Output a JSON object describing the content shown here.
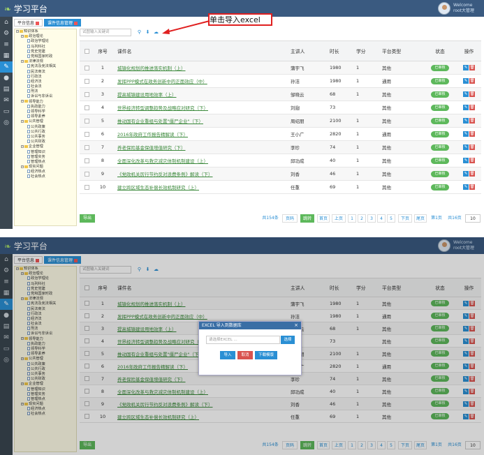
{
  "app": {
    "title": "学习平台",
    "welcome_line1": "Welcome",
    "welcome_line2": "root大管理"
  },
  "tabs": [
    {
      "label": "平台信息"
    },
    {
      "label": "课件信息管理"
    }
  ],
  "sidebar_icons": [
    "home-icon",
    "settings-icon",
    "list-icon",
    "grid-icon",
    "pen-icon",
    "chat-icon",
    "document-icon",
    "mail-icon",
    "monitor-icon",
    "circle-icon"
  ],
  "tree": [
    {
      "level": 1,
      "kind": "folder",
      "label": "知识体系"
    },
    {
      "level": 2,
      "kind": "folder",
      "label": "政治理论"
    },
    {
      "level": 3,
      "kind": "file",
      "label": "政治学理论"
    },
    {
      "level": 3,
      "kind": "file",
      "label": "马列科社"
    },
    {
      "level": 3,
      "kind": "file",
      "label": "党史党建"
    },
    {
      "level": 3,
      "kind": "file",
      "label": "党和国家时政"
    },
    {
      "level": 2,
      "kind": "folder",
      "label": "法律法规"
    },
    {
      "level": 3,
      "kind": "file",
      "label": "宪法及宪法相关"
    },
    {
      "level": 3,
      "kind": "file",
      "label": "民法商法"
    },
    {
      "level": 3,
      "kind": "file",
      "label": "行政法"
    },
    {
      "level": 3,
      "kind": "file",
      "label": "经济法"
    },
    {
      "level": 3,
      "kind": "file",
      "label": "社会法"
    },
    {
      "level": 3,
      "kind": "file",
      "label": "刑法"
    },
    {
      "level": 3,
      "kind": "file",
      "label": "诉讼与非诉讼"
    },
    {
      "level": 2,
      "kind": "folder",
      "label": "领导能力"
    },
    {
      "level": 3,
      "kind": "file",
      "label": "执政能力"
    },
    {
      "level": 3,
      "kind": "file",
      "label": "领导科学"
    },
    {
      "level": 3,
      "kind": "file",
      "label": "领导素养"
    },
    {
      "level": 2,
      "kind": "folder",
      "label": "公共管理"
    },
    {
      "level": 3,
      "kind": "file",
      "label": "公共政策"
    },
    {
      "level": 3,
      "kind": "file",
      "label": "公共行政"
    },
    {
      "level": 3,
      "kind": "file",
      "label": "公共事务"
    },
    {
      "level": 3,
      "kind": "file",
      "label": "公共财政"
    },
    {
      "level": 2,
      "kind": "folder",
      "label": "企业管理"
    },
    {
      "level": 3,
      "kind": "file",
      "label": "管理知识"
    },
    {
      "level": 3,
      "kind": "file",
      "label": "管理实务"
    },
    {
      "level": 3,
      "kind": "file",
      "label": "管理热点"
    },
    {
      "level": 2,
      "kind": "folder",
      "label": "现实问题"
    },
    {
      "level": 3,
      "kind": "file",
      "label": "经济热点"
    },
    {
      "level": 3,
      "kind": "file",
      "label": "社会热点"
    }
  ],
  "search": {
    "placeholder": "试图输入关键词"
  },
  "toolbar_icons": [
    "search-icon",
    "download-icon",
    "upload-icon"
  ],
  "table": {
    "headers": {
      "num": "序号",
      "name": "课件名",
      "speaker": "主讲人",
      "duration": "时长",
      "credit": "学分",
      "platform": "平台类型",
      "status": "状态",
      "ops": "操作"
    },
    "rows": [
      {
        "num": "1",
        "name": "城镇化规划的推进落实机制（上）",
        "speaker": "蒲宇飞",
        "duration": "1980",
        "credit": "1",
        "platform": "其他",
        "status": "已审核"
      },
      {
        "num": "2",
        "name": "发挥PPP模式在政务创新中的正面效应（中）",
        "speaker": "孙洁",
        "duration": "1980",
        "credit": "1",
        "platform": "通用",
        "status": "已审核"
      },
      {
        "num": "3",
        "name": "提高城镇建设用地效率（上）",
        "speaker": "邹晓云",
        "duration": "68",
        "credit": "1",
        "platform": "其他",
        "status": "已审核"
      },
      {
        "num": "4",
        "name": "世界经济转型调整趋势及战略应对研究（下）",
        "speaker": "刘翅",
        "duration": "73",
        "credit": "",
        "platform": "其他",
        "status": "已审核"
      },
      {
        "num": "5",
        "name": "推动国有企业重组与处置\"僵尸企业\"（下）",
        "speaker": "周绍朋",
        "duration": "2100",
        "credit": "1",
        "platform": "其他",
        "status": "已审核"
      },
      {
        "num": "6",
        "name": "2016年政府工作报告精解读（下）",
        "speaker": "王小广",
        "duration": "2820",
        "credit": "1",
        "platform": "通用",
        "status": "已审核"
      },
      {
        "num": "7",
        "name": "养老保险基金保值增值研究（下）",
        "speaker": "李珍",
        "duration": "74",
        "credit": "1",
        "platform": "其他",
        "status": "已审核"
      },
      {
        "num": "8",
        "name": "全面深化改革与救灾减灾体制机制建设（上）",
        "speaker": "邱功成",
        "duration": "40",
        "credit": "1",
        "platform": "其他",
        "status": "已审核"
      },
      {
        "num": "9",
        "name": "《党政机关厉行节约反对浪费条例》解读（下）",
        "speaker": "刘香",
        "duration": "46",
        "credit": "1",
        "platform": "其他",
        "status": "已审核"
      },
      {
        "num": "10",
        "name": "建立跨区域生态补偿长效机制研究（上）",
        "speaker": "任重",
        "duration": "69",
        "credit": "1",
        "platform": "其他",
        "status": "已审核"
      }
    ]
  },
  "pager": {
    "export_label": "导出",
    "total_text": "共154条",
    "page_label": "页码",
    "go_label": "跳转",
    "first": "首页",
    "prev": "上页",
    "pages": [
      "1",
      "2",
      "3",
      "4",
      "5"
    ],
    "next": "下页",
    "last": "尾页",
    "current_page_text": "第1页",
    "total_pages_text": "共16页",
    "page_size": "10"
  },
  "callout": {
    "text": "单击导入excel"
  },
  "modal": {
    "title": "EXCEL 导入到数据库",
    "input_placeholder": "请选择EXCEL ...",
    "pick_label": "选择",
    "import_label": "导入",
    "cancel_label": "取消",
    "template_label": "下载模版",
    "close_glyph": "×"
  },
  "colors": {
    "topbar": "#3a5a80",
    "accent_blue": "#2a8fd4",
    "status_green": "#5db85b",
    "delete_red": "#d9534f",
    "callout_red": "#e02020"
  }
}
